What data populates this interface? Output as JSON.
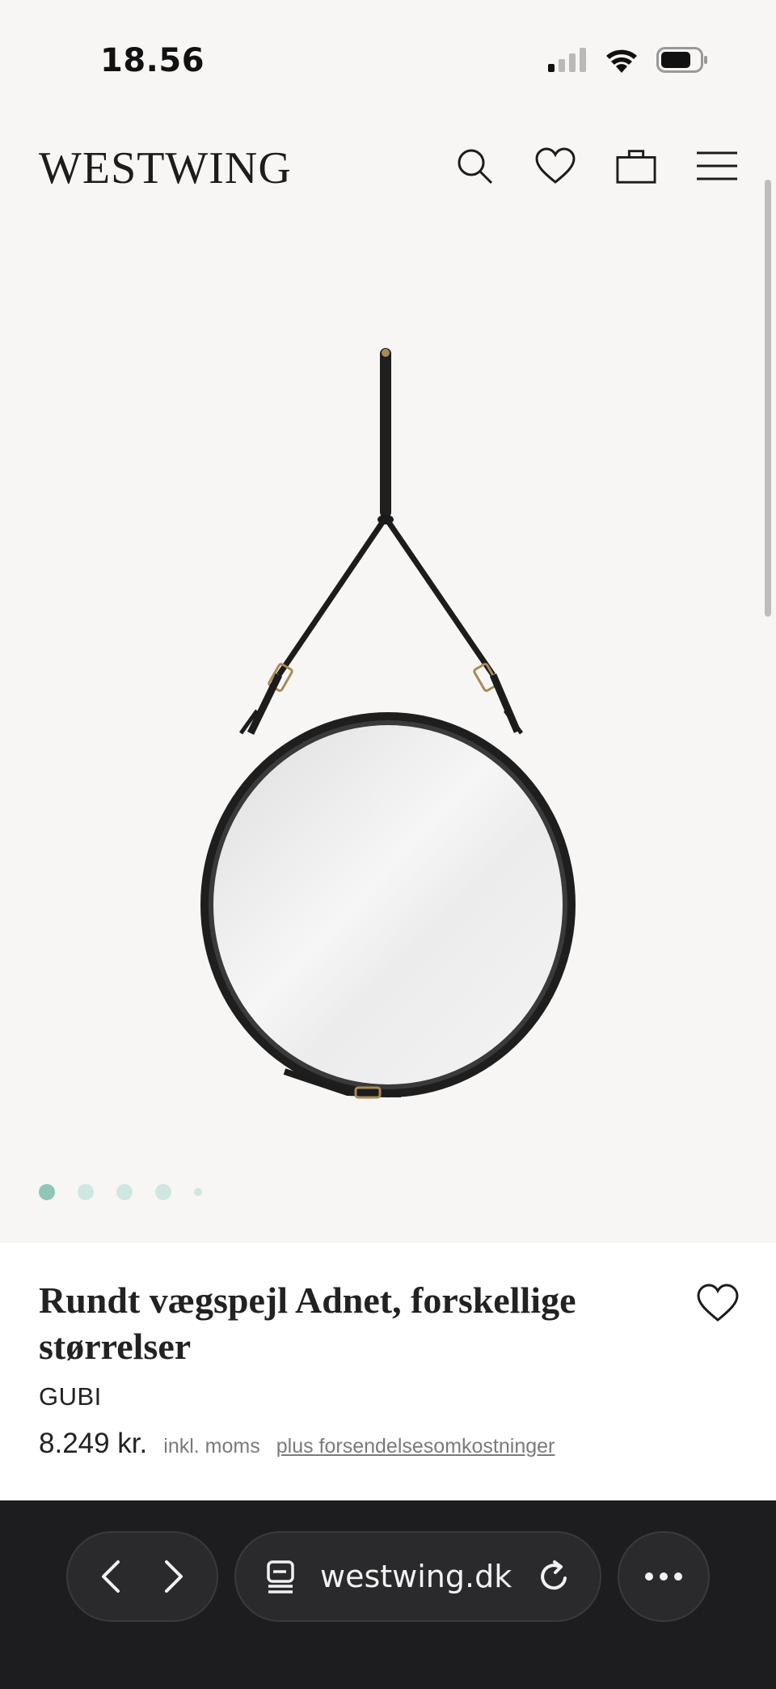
{
  "status_bar": {
    "time": "18.56",
    "icons": [
      "signal-icon",
      "wifi-icon",
      "battery-icon"
    ]
  },
  "header": {
    "logo": "WESTWING",
    "icons": [
      "search-icon",
      "heart-icon",
      "bag-icon",
      "menu-icon"
    ]
  },
  "gallery": {
    "image": "round-leather-wall-mirror",
    "dot_count": 5,
    "active_index": 0
  },
  "product": {
    "title": "Rundt vægspejl Adnet, forskellige størrelser",
    "brand": "GUBI",
    "price": "8.249 kr.",
    "tax_note": "inkl. moms",
    "shipping_link": "plus forsendelsesomkostninger"
  },
  "browser": {
    "url": "westwing.dk",
    "icons": [
      "back-icon",
      "forward-icon",
      "tabs-icon",
      "reload-icon",
      "more-icon"
    ]
  },
  "colors": {
    "background": "#f8f6f5",
    "dot_active": "#8fc6b8",
    "dot_inactive": "#cfe7e1",
    "browser_bar": "#1d1d1f"
  }
}
